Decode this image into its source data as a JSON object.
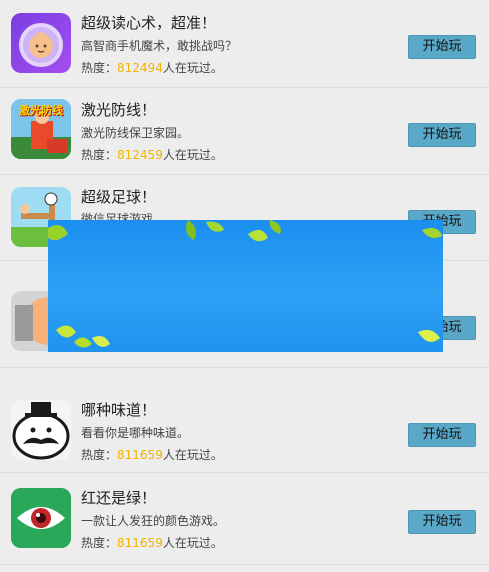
{
  "play_label": "开始玩",
  "heat_label": "热度：",
  "heat_suffix": "人在玩过。",
  "colors": {
    "background": "#ededed",
    "button": "#5aa8c8",
    "hot_number": "#f0b400",
    "overlay_blue": "#1f93ee",
    "leaf_green": "#9ad12a"
  },
  "games": [
    {
      "title": "超级读心术，超准！",
      "desc": "高智商手机魔术，敢挑战吗？",
      "count": "812494",
      "icon": "crystal-ball-baby-icon"
    },
    {
      "title": "激光防线！",
      "desc": "激光防线保卫家园。",
      "count": "812459",
      "icon": "laser-defense-game-icon",
      "icon_text": "激光防线"
    },
    {
      "title": "超级足球！",
      "desc": "微信足球游戏",
      "icon": "soccer-game-icon"
    },
    {
      "icon": "hand-game-icon"
    },
    {
      "title": "哪种味道！",
      "desc": "看看你是哪种味道。",
      "count": "811659",
      "icon": "mustache-face-icon"
    },
    {
      "title": "红还是绿！",
      "desc": "一款让人发狂的颜色游戏。",
      "count": "811659",
      "icon": "eye-icon"
    }
  ]
}
